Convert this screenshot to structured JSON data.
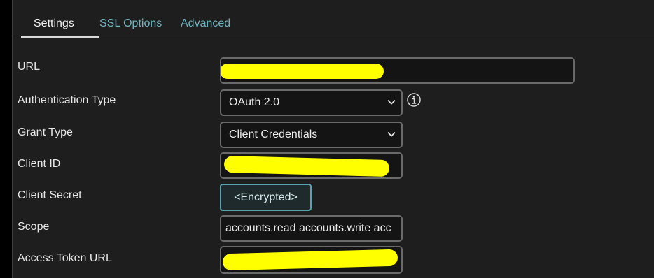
{
  "tabs": [
    {
      "label": "Settings",
      "active": true
    },
    {
      "label": "SSL Options",
      "active": false
    },
    {
      "label": "Advanced",
      "active": false
    }
  ],
  "form": {
    "url": {
      "label": "URL",
      "value": ""
    },
    "auth_type": {
      "label": "Authentication Type",
      "value": "OAuth 2.0"
    },
    "grant_type": {
      "label": "Grant Type",
      "value": "Client Credentials"
    },
    "client_id": {
      "label": "Client ID",
      "value": ""
    },
    "client_secret": {
      "label": "Client Secret",
      "button_label": "<Encrypted>"
    },
    "scope": {
      "label": "Scope",
      "value": "accounts.read accounts.write acc"
    },
    "access_token_url": {
      "label": "Access Token URL",
      "value": ""
    }
  },
  "icons": {
    "info": "info-icon",
    "dropdown": "chevron-down-icon"
  },
  "colors": {
    "background": "#1e1e1e",
    "accent": "#6fb3bf",
    "redaction": "#ffff00"
  }
}
